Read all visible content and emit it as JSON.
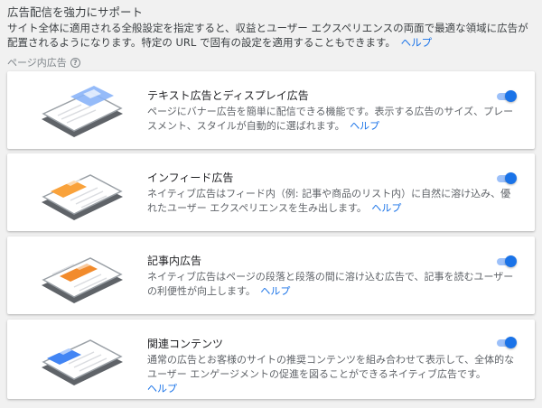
{
  "header": {
    "title": "広告配信を強力にサポート",
    "description": "サイト全体に適用される全般設定を指定すると、収益とユーザー エクスペリエンスの両面で最適な領域に広告が配置されるようになります。特定の URL で固有の設定を適用することもできます。",
    "help_link": "ヘルプ"
  },
  "section": {
    "label": "ページ内広告",
    "help_icon": "question-circle-icon"
  },
  "cards": [
    {
      "title": "テキスト広告とディスプレイ広告",
      "description": "ページにバナー広告を簡単に配信できる機能です。表示する広告のサイズ、プレースメント、スタイルが自動的に選ばれます。",
      "help_link": "ヘルプ",
      "toggle_on": true,
      "accent_color": "#8ab4f8"
    },
    {
      "title": "インフィード広告",
      "description": "ネイティブ広告はフィード内（例: 記事や商品のリスト内）に自然に溶け込み、優れたユーザー エクスペリエンスを生み出します。",
      "help_link": "ヘルプ",
      "toggle_on": true,
      "accent_color": "#f9a23b"
    },
    {
      "title": "記事内広告",
      "description": "ネイティブ広告はページの段落と段落の間に溶け込む広告で、記事を読むユーザーの利便性が向上します。",
      "help_link": "ヘルプ",
      "toggle_on": true,
      "accent_color": "#f28b2c"
    },
    {
      "title": "関連コンテンツ",
      "description": "通常の広告とお客様のサイトの推奨コンテンツを組み合わせて表示して、全体的なユーザー エンゲージメントの促進を図ることができるネイティブ広告です。",
      "help_link": "ヘルプ",
      "toggle_on": true,
      "accent_color": "#4285f4"
    }
  ],
  "colors": {
    "link": "#1a73e8",
    "toggle_on": "#1a73e8",
    "toggle_track": "#9cc0f9",
    "background": "#f1f1f1"
  }
}
